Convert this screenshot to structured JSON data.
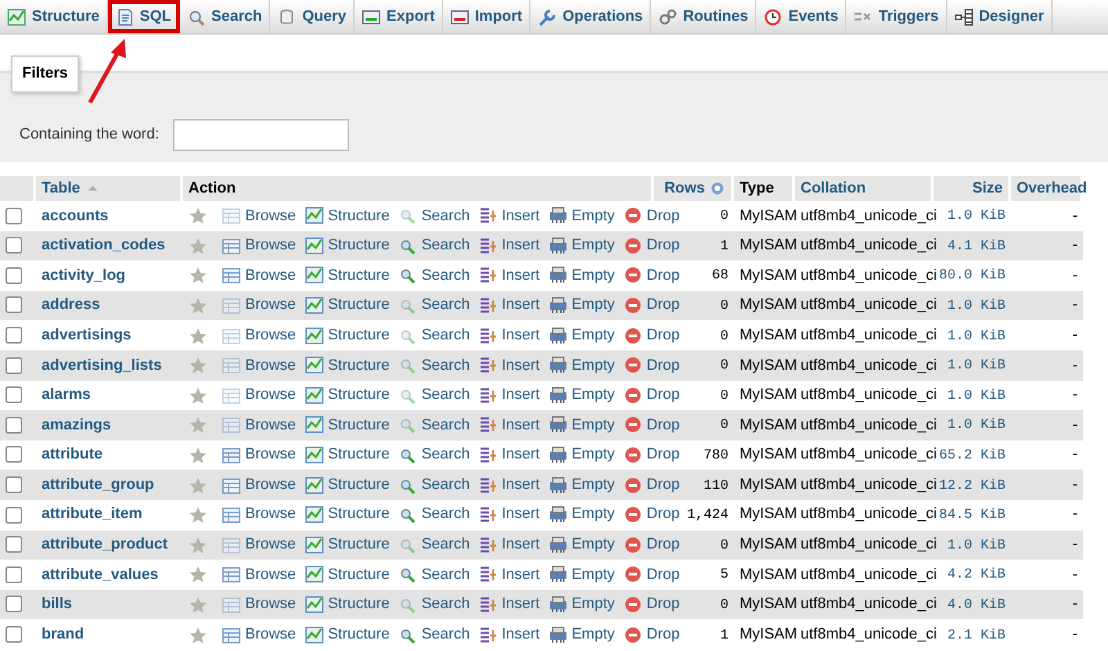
{
  "tabs": [
    {
      "label": "Structure",
      "selected": false,
      "highlighted": false
    },
    {
      "label": "SQL",
      "selected": false,
      "highlighted": true
    },
    {
      "label": "Search",
      "selected": false,
      "highlighted": false
    },
    {
      "label": "Query",
      "selected": false,
      "highlighted": false
    },
    {
      "label": "Export",
      "selected": false,
      "highlighted": false
    },
    {
      "label": "Import",
      "selected": false,
      "highlighted": false
    },
    {
      "label": "Operations",
      "selected": false,
      "highlighted": false
    },
    {
      "label": "Routines",
      "selected": false,
      "highlighted": false
    },
    {
      "label": "Events",
      "selected": false,
      "highlighted": false
    },
    {
      "label": "Triggers",
      "selected": false,
      "highlighted": false
    },
    {
      "label": "Designer",
      "selected": false,
      "highlighted": false
    }
  ],
  "filters": {
    "legend": "Filters",
    "label": "Containing the word:"
  },
  "table": {
    "columns": [
      "Table",
      "Action",
      "Rows",
      "Type",
      "Collation",
      "Size",
      "Overhead"
    ],
    "rows": [
      {
        "name": "accounts",
        "checked": false,
        "favorite": false,
        "empty": true,
        "actions": [
          "Browse",
          "Structure",
          "Search",
          "Insert",
          "Empty",
          "Drop"
        ],
        "rows": "0",
        "type": "MyISAM",
        "collation": "utf8mb4_unicode_ci",
        "size": "1.0 KiB",
        "overhead": "-"
      },
      {
        "name": "activation_codes",
        "checked": false,
        "favorite": false,
        "empty": false,
        "actions": [
          "Browse",
          "Structure",
          "Search",
          "Insert",
          "Empty",
          "Drop"
        ],
        "rows": "1",
        "type": "MyISAM",
        "collation": "utf8mb4_unicode_ci",
        "size": "4.1 KiB",
        "overhead": "-"
      },
      {
        "name": "activity_log",
        "checked": false,
        "favorite": false,
        "empty": false,
        "actions": [
          "Browse",
          "Structure",
          "Search",
          "Insert",
          "Empty",
          "Drop"
        ],
        "rows": "68",
        "type": "MyISAM",
        "collation": "utf8mb4_unicode_ci",
        "size": "80.0 KiB",
        "overhead": "-"
      },
      {
        "name": "address",
        "checked": false,
        "favorite": false,
        "empty": true,
        "actions": [
          "Browse",
          "Structure",
          "Search",
          "Insert",
          "Empty",
          "Drop"
        ],
        "rows": "0",
        "type": "MyISAM",
        "collation": "utf8mb4_unicode_ci",
        "size": "1.0 KiB",
        "overhead": "-"
      },
      {
        "name": "advertisings",
        "checked": false,
        "favorite": false,
        "empty": true,
        "actions": [
          "Browse",
          "Structure",
          "Search",
          "Insert",
          "Empty",
          "Drop"
        ],
        "rows": "0",
        "type": "MyISAM",
        "collation": "utf8mb4_unicode_ci",
        "size": "1.0 KiB",
        "overhead": "-"
      },
      {
        "name": "advertising_lists",
        "checked": false,
        "favorite": false,
        "empty": true,
        "actions": [
          "Browse",
          "Structure",
          "Search",
          "Insert",
          "Empty",
          "Drop"
        ],
        "rows": "0",
        "type": "MyISAM",
        "collation": "utf8mb4_unicode_ci",
        "size": "1.0 KiB",
        "overhead": "-"
      },
      {
        "name": "alarms",
        "checked": false,
        "favorite": false,
        "empty": true,
        "actions": [
          "Browse",
          "Structure",
          "Search",
          "Insert",
          "Empty",
          "Drop"
        ],
        "rows": "0",
        "type": "MyISAM",
        "collation": "utf8mb4_unicode_ci",
        "size": "1.0 KiB",
        "overhead": "-"
      },
      {
        "name": "amazings",
        "checked": false,
        "favorite": false,
        "empty": true,
        "actions": [
          "Browse",
          "Structure",
          "Search",
          "Insert",
          "Empty",
          "Drop"
        ],
        "rows": "0",
        "type": "MyISAM",
        "collation": "utf8mb4_unicode_ci",
        "size": "1.0 KiB",
        "overhead": "-"
      },
      {
        "name": "attribute",
        "checked": false,
        "favorite": false,
        "empty": false,
        "actions": [
          "Browse",
          "Structure",
          "Search",
          "Insert",
          "Empty",
          "Drop"
        ],
        "rows": "780",
        "type": "MyISAM",
        "collation": "utf8mb4_unicode_ci",
        "size": "65.2 KiB",
        "overhead": "-"
      },
      {
        "name": "attribute_group",
        "checked": false,
        "favorite": false,
        "empty": false,
        "actions": [
          "Browse",
          "Structure",
          "Search",
          "Insert",
          "Empty",
          "Drop"
        ],
        "rows": "110",
        "type": "MyISAM",
        "collation": "utf8mb4_unicode_ci",
        "size": "12.2 KiB",
        "overhead": "-"
      },
      {
        "name": "attribute_item",
        "checked": false,
        "favorite": false,
        "empty": false,
        "actions": [
          "Browse",
          "Structure",
          "Search",
          "Insert",
          "Empty",
          "Drop"
        ],
        "rows": "1,424",
        "type": "MyISAM",
        "collation": "utf8mb4_unicode_ci",
        "size": "84.5 KiB",
        "overhead": "-"
      },
      {
        "name": "attribute_product",
        "checked": false,
        "favorite": false,
        "empty": true,
        "actions": [
          "Browse",
          "Structure",
          "Search",
          "Insert",
          "Empty",
          "Drop"
        ],
        "rows": "0",
        "type": "MyISAM",
        "collation": "utf8mb4_unicode_ci",
        "size": "1.0 KiB",
        "overhead": "-"
      },
      {
        "name": "attribute_values",
        "checked": false,
        "favorite": false,
        "empty": false,
        "actions": [
          "Browse",
          "Structure",
          "Search",
          "Insert",
          "Empty",
          "Drop"
        ],
        "rows": "5",
        "type": "MyISAM",
        "collation": "utf8mb4_unicode_ci",
        "size": "4.2 KiB",
        "overhead": "-"
      },
      {
        "name": "bills",
        "checked": false,
        "favorite": false,
        "empty": true,
        "actions": [
          "Browse",
          "Structure",
          "Search",
          "Insert",
          "Empty",
          "Drop"
        ],
        "rows": "0",
        "type": "MyISAM",
        "collation": "utf8mb4_unicode_ci",
        "size": "4.0 KiB",
        "overhead": "-"
      },
      {
        "name": "brand",
        "checked": false,
        "favorite": false,
        "empty": false,
        "actions": [
          "Browse",
          "Structure",
          "Search",
          "Insert",
          "Empty",
          "Drop"
        ],
        "rows": "1",
        "type": "MyISAM",
        "collation": "utf8mb4_unicode_ci",
        "size": "2.1 KiB",
        "overhead": "-"
      }
    ]
  }
}
